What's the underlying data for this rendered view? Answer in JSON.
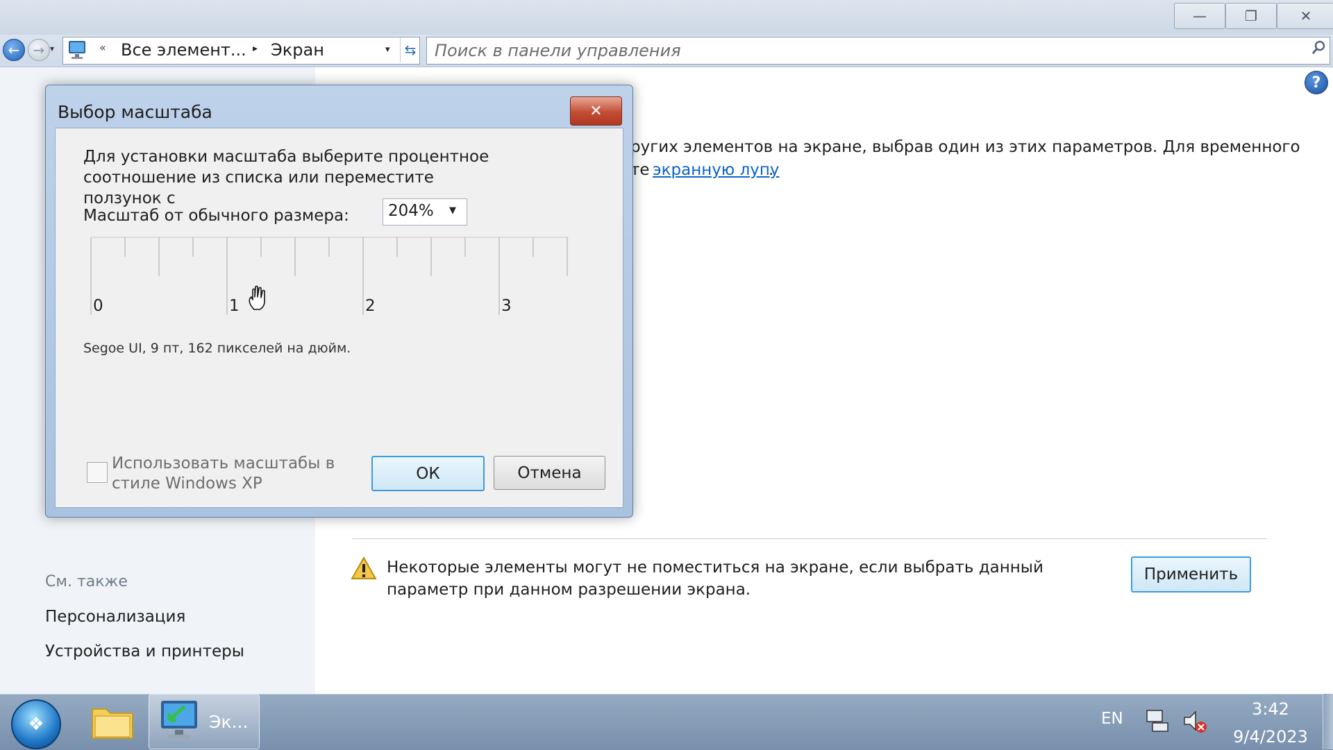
{
  "window": {
    "minimize_glyph": "—",
    "restore_glyph": "❐",
    "close_glyph": "✕"
  },
  "navigation": {
    "address_parts": [
      "Все элемент...",
      "Экран"
    ],
    "address_chevron": "«",
    "address_arrow": "▸",
    "dropdown_glyph": "▾",
    "search_placeholder": "Поиск в панели управления"
  },
  "content": {
    "description_line1": "ругих элементов на экране, выбрав один из этих параметров. Для временного",
    "description_line2_prefix": "те",
    "magnifier_link": "экранную лупу",
    "description_period": ".",
    "warning_text": "Некоторые элементы могут не поместиться на экране, если выбрать данный параметр при данном разрешении экрана.",
    "apply_label": "Применить"
  },
  "see_also": {
    "header": "См. также",
    "links": [
      "Персонализация",
      "Устройства и принтеры"
    ]
  },
  "dialog": {
    "title": "Выбор масштаба",
    "close_glyph": "✕",
    "instruction": "Для установки масштаба выберите процентное соотношение из списка или переместите ползунок с",
    "scale_label": "Масштаб от обычного размера:",
    "scale_value": "204%",
    "ruler_labels": [
      "0",
      "1",
      "2",
      "3"
    ],
    "font_info": "Segoe UI, 9 пт, 162 пикселей на дюйм.",
    "xp_checkbox_label": "Использовать масштабы в стиле Windows XP",
    "xp_checkbox_checked": false,
    "ok_label": "ОК",
    "cancel_label": "Отмена"
  },
  "taskbar": {
    "active_app_label": "Эк...",
    "language": "EN",
    "time": "3:42",
    "date": "9/4/2023"
  },
  "icons": {
    "back": "back-arrow-icon",
    "forward": "forward-arrow-icon",
    "computer": "computer-icon",
    "refresh": "refresh-icon",
    "search": "search-icon",
    "help": "help-icon",
    "warning": "warning-icon",
    "hand_cursor": "hand-cursor-icon",
    "start": "windows-start-icon",
    "folder": "folder-icon",
    "network": "network-icon",
    "volume_muted": "volume-muted-icon"
  },
  "colors": {
    "link": "#0b63c5",
    "accent_button_border": "#3c9be0",
    "dialog_close": "#c24d35",
    "taskbar": "#7890ad"
  }
}
